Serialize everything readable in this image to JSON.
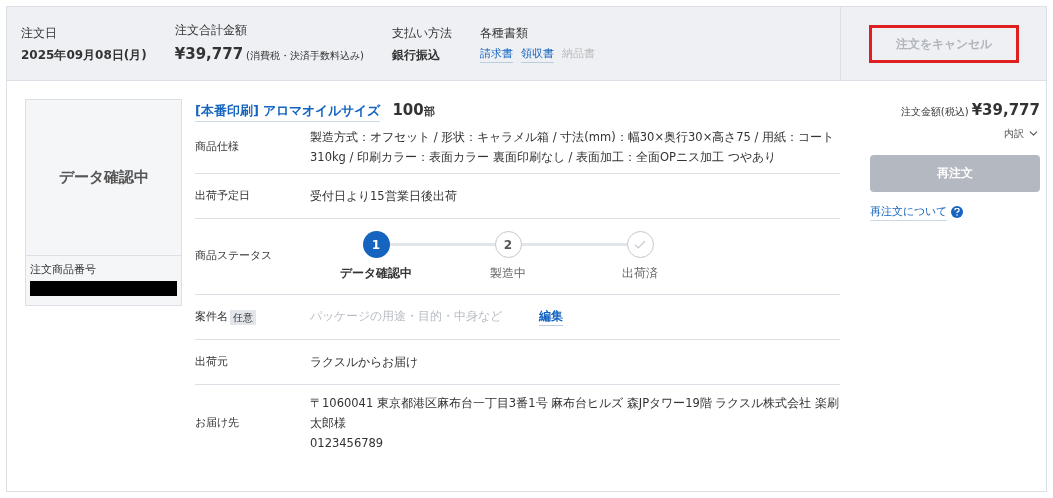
{
  "summary": {
    "fields": [
      {
        "label": "注文日",
        "value": "2025年09月08日(月)"
      },
      {
        "label": "注文合計金額",
        "value": "¥39,777",
        "note": "(消費税・決済手数料込み)"
      },
      {
        "label": "支払い方法",
        "value": "銀行振込"
      }
    ],
    "documents": {
      "label": "各種書類",
      "links": [
        {
          "text": "請求書",
          "disabled": false
        },
        {
          "text": "領収書",
          "disabled": false
        },
        {
          "text": "納品書",
          "disabled": true
        }
      ]
    },
    "cancel_button": {
      "label": "注文をキャンセル",
      "disabled": true,
      "highlighted": true
    }
  },
  "item": {
    "thumbnail": {
      "status": "データ確認中",
      "number_label": "注文商品番号",
      "number_redacted": true
    },
    "title": "[本番印刷] アロマオイルサイズ",
    "quantity": "100",
    "unit": "部",
    "rows": [
      {
        "kind": "text",
        "label": "商品仕様",
        "value": "製造方式：オフセット / 形状：キャラメル箱 / 寸法(mm)：幅30×奥行30×高さ75 / 用紙：コート310kg / 印刷カラー：表面カラー 裏面印刷なし / 表面加工：全面OPニス加工 つやあり"
      },
      {
        "kind": "text",
        "label": "出荷予定日",
        "value": "受付日より15営業日後出荷"
      },
      {
        "kind": "status",
        "label": "商品ステータス",
        "steps": [
          {
            "mark": "1",
            "name": "データ確認中",
            "selected": true
          },
          {
            "mark": "2",
            "name": "製造中",
            "selected": false
          },
          {
            "kind": "check",
            "name": "出荷済",
            "selected": false
          }
        ]
      },
      {
        "kind": "editable",
        "label": "案件名",
        "tag": "任意",
        "placeholder": "パッケージの用途・目的・中身など",
        "action": "編集"
      },
      {
        "kind": "text",
        "label": "出荷元",
        "value": "ラクスルからお届け"
      },
      {
        "kind": "lines",
        "label": "お届け先",
        "lines": [
          "〒1060041 東京都港区麻布台一丁目3番1号 麻布台ヒルズ 森JPタワー19階 ラクスル株式会社 楽刷太郎様",
          "0123456789"
        ]
      }
    ]
  },
  "side": {
    "price_label": "注文金額(税込)",
    "price": "¥39,777",
    "breakdown": "内訳",
    "reorder_button": {
      "label": "再注文",
      "disabled": true
    },
    "reorder_help": "再注文について"
  }
}
